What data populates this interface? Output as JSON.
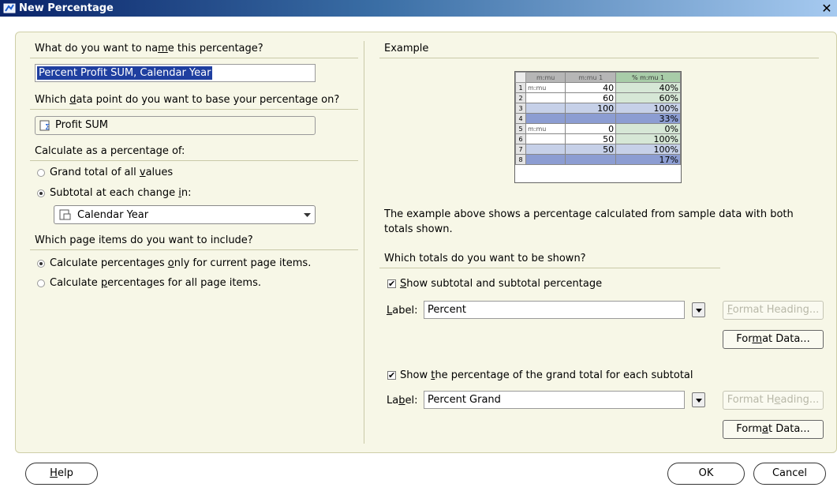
{
  "window": {
    "title": "New Percentage",
    "close": "✕"
  },
  "left": {
    "name_q": "What do you want to name this percentage?",
    "name_value": "Percent Profit SUM, Calendar Year",
    "datapoint_q_pre": "Which ",
    "datapoint_q_u": "d",
    "datapoint_q_post": "ata point do you want to base your percentage on?",
    "datapoint_value": "Profit SUM",
    "calc_q": "Calculate as a percentage of:",
    "radio_grand_pre": "Grand total of all ",
    "radio_grand_u": "v",
    "radio_grand_post": "alues",
    "radio_sub_pre": "Subtotal at each change ",
    "radio_sub_u": "i",
    "radio_sub_post": "n:",
    "change_select": "Calendar Year",
    "page_q": "Which page items do you want to include?",
    "radio_current_pre": "Calculate percentages ",
    "radio_current_u": "o",
    "radio_current_post": "nly for current page items.",
    "radio_all_pre": "Calculate ",
    "radio_all_u": "p",
    "radio_all_post": "ercentages for all page items."
  },
  "right": {
    "example_heading": "Example",
    "example_table": {
      "headers": [
        "m:mu",
        "m:mu 1",
        "% m:mu 1"
      ],
      "rows": [
        {
          "n": "1",
          "a": "m:mu",
          "b": "40",
          "c": "40%",
          "kind": "data"
        },
        {
          "n": "2",
          "a": "",
          "b": "60",
          "c": "60%",
          "kind": "data"
        },
        {
          "n": "3",
          "a": "",
          "b": "100",
          "c": "100%",
          "kind": "sub"
        },
        {
          "n": "4",
          "a": "",
          "b": "",
          "c": "33%",
          "kind": "tot"
        },
        {
          "n": "5",
          "a": "m:mu",
          "b": "0",
          "c": "0%",
          "kind": "data"
        },
        {
          "n": "6",
          "a": "",
          "b": "50",
          "c": "100%",
          "kind": "data"
        },
        {
          "n": "7",
          "a": "",
          "b": "50",
          "c": "100%",
          "kind": "sub"
        },
        {
          "n": "8",
          "a": "",
          "b": "",
          "c": "17%",
          "kind": "tot"
        }
      ]
    },
    "example_desc": "The example above shows a percentage calculated from sample data with both totals shown.",
    "totals_q": "Which totals do you want to be shown?",
    "subtotal_check_u": "S",
    "subtotal_check_post": "how subtotal and subtotal percentage",
    "label1_pre": "",
    "label1_u": "L",
    "label1_post": "abel:",
    "label1_value": "Percent",
    "format_heading_1_pre": "",
    "format_heading_1_u": "F",
    "format_heading_1_post": "ormat Heading...",
    "format_data_1_pre": "For",
    "format_data_1_u": "m",
    "format_data_1_post": "at Data...",
    "grand_check_pre": "Show ",
    "grand_check_u": "t",
    "grand_check_post": "he percentage of the grand total for each subtotal",
    "label2_pre": "La",
    "label2_u": "b",
    "label2_post": "el:",
    "label2_value": "Percent Grand",
    "format_heading_2_pre": "Format H",
    "format_heading_2_u": "e",
    "format_heading_2_post": "ading...",
    "format_data_2_pre": "Form",
    "format_data_2_u": "a",
    "format_data_2_post": "t Data..."
  },
  "footer": {
    "help_u": "H",
    "help_post": "elp",
    "ok": "OK",
    "cancel": "Cancel"
  }
}
